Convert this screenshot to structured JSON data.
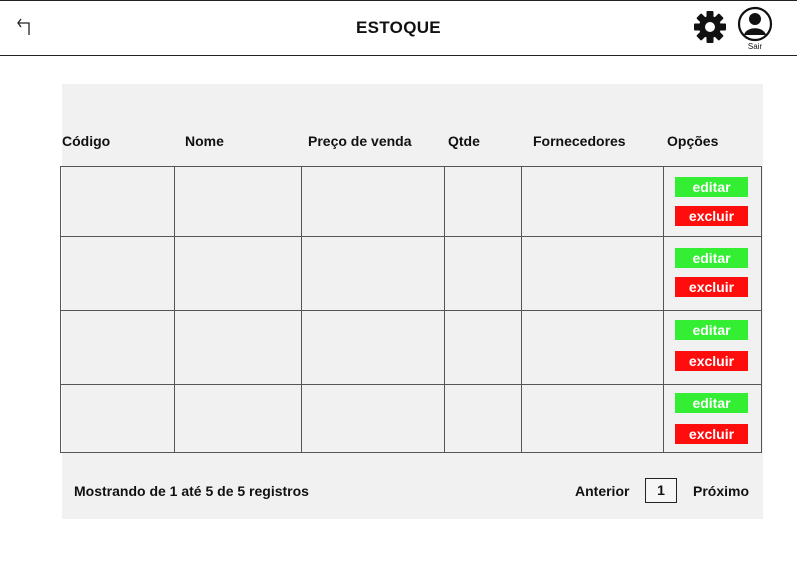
{
  "header": {
    "title": "ESTOQUE",
    "back_icon": "back-arrow-icon",
    "settings_icon": "gear-icon",
    "user_icon": "user-avatar-icon",
    "logout_label": "Sair"
  },
  "table": {
    "columns": [
      "Código",
      "Nome",
      "Preço de venda",
      "Qtde",
      "Fornecedores",
      "Opções"
    ],
    "rows": [
      {
        "codigo": "",
        "nome": "",
        "preco": "",
        "qtde": "",
        "fornecedores": "",
        "edit_label": "editar",
        "delete_label": "excluir"
      },
      {
        "codigo": "",
        "nome": "",
        "preco": "",
        "qtde": "",
        "fornecedores": "",
        "edit_label": "editar",
        "delete_label": "excluir"
      },
      {
        "codigo": "",
        "nome": "",
        "preco": "",
        "qtde": "",
        "fornecedores": "",
        "edit_label": "editar",
        "delete_label": "excluir"
      },
      {
        "codigo": "",
        "nome": "",
        "preco": "",
        "qtde": "",
        "fornecedores": "",
        "edit_label": "editar",
        "delete_label": "excluir"
      }
    ]
  },
  "footer": {
    "summary": "Mostrando de 1 até 5 de 5 registros",
    "prev_label": "Anterior",
    "current_page": "1",
    "next_label": "Próximo"
  },
  "colors": {
    "edit": "#33ee33",
    "delete": "#ff0d0d",
    "panel": "#f1f1f1"
  }
}
